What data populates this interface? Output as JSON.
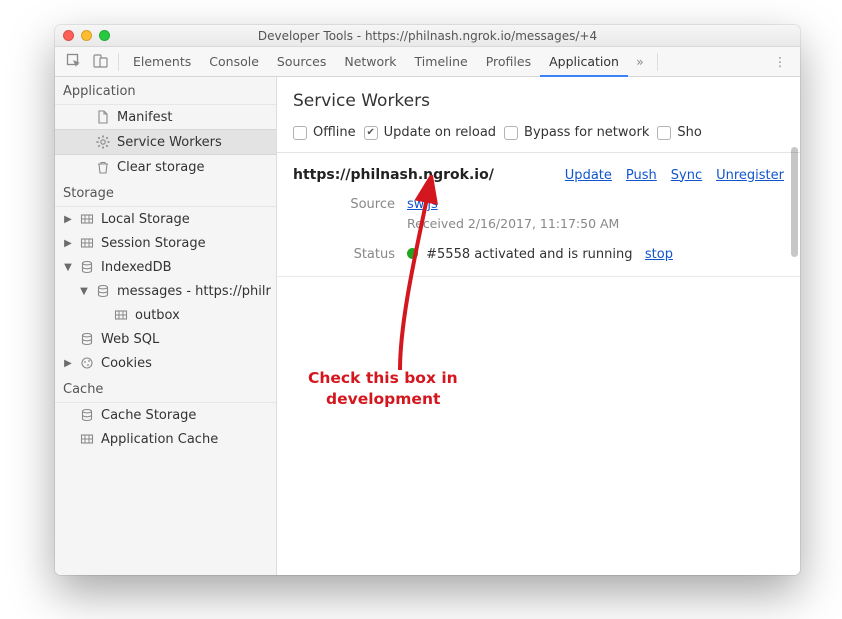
{
  "window": {
    "title": "Developer Tools - https://philnash.ngrok.io/messages/+4"
  },
  "tabs": {
    "items": [
      "Elements",
      "Console",
      "Sources",
      "Network",
      "Timeline",
      "Profiles",
      "Application"
    ],
    "active": "Application",
    "more_glyph": "»"
  },
  "sidebar": {
    "sections": [
      {
        "title": "Application",
        "items": [
          {
            "icon": "file",
            "label": "Manifest",
            "depth": 2
          },
          {
            "icon": "gear",
            "label": "Service Workers",
            "depth": 2,
            "selected": true
          },
          {
            "icon": "trash",
            "label": "Clear storage",
            "depth": 2
          }
        ]
      },
      {
        "title": "Storage",
        "items": [
          {
            "caret": "right",
            "icon": "grid",
            "label": "Local Storage",
            "depth": 1
          },
          {
            "caret": "right",
            "icon": "grid",
            "label": "Session Storage",
            "depth": 1
          },
          {
            "caret": "down",
            "icon": "db",
            "label": "IndexedDB",
            "depth": 1
          },
          {
            "caret": "down",
            "icon": "db",
            "label": "messages - https://philr",
            "depth": 2
          },
          {
            "caret": "blank",
            "icon": "grid",
            "label": "outbox",
            "depth": 3
          },
          {
            "caret": "blank",
            "icon": "db",
            "label": "Web SQL",
            "depth": 1
          },
          {
            "caret": "right",
            "icon": "cookie",
            "label": "Cookies",
            "depth": 1
          }
        ]
      },
      {
        "title": "Cache",
        "items": [
          {
            "caret": "blank",
            "icon": "db",
            "label": "Cache Storage",
            "depth": 1
          },
          {
            "caret": "blank",
            "icon": "grid",
            "label": "Application Cache",
            "depth": 1
          }
        ]
      }
    ]
  },
  "panel": {
    "title": "Service Workers",
    "checks": [
      {
        "label": "Offline",
        "checked": false
      },
      {
        "label": "Update on reload",
        "checked": true
      },
      {
        "label": "Bypass for network",
        "checked": false
      },
      {
        "label": "Sho",
        "checked": false
      }
    ],
    "origin": "https://philnash.ngrok.io/",
    "actions": [
      "Update",
      "Push",
      "Sync",
      "Unregister"
    ],
    "source_label": "Source",
    "source_link": "sw.js",
    "received": "Received 2/16/2017, 11:17:50 AM",
    "status_label": "Status",
    "status_text": "#5558 activated and is running",
    "stop": "stop"
  },
  "annotation": {
    "line1": "Check this box in",
    "line2": "development"
  }
}
